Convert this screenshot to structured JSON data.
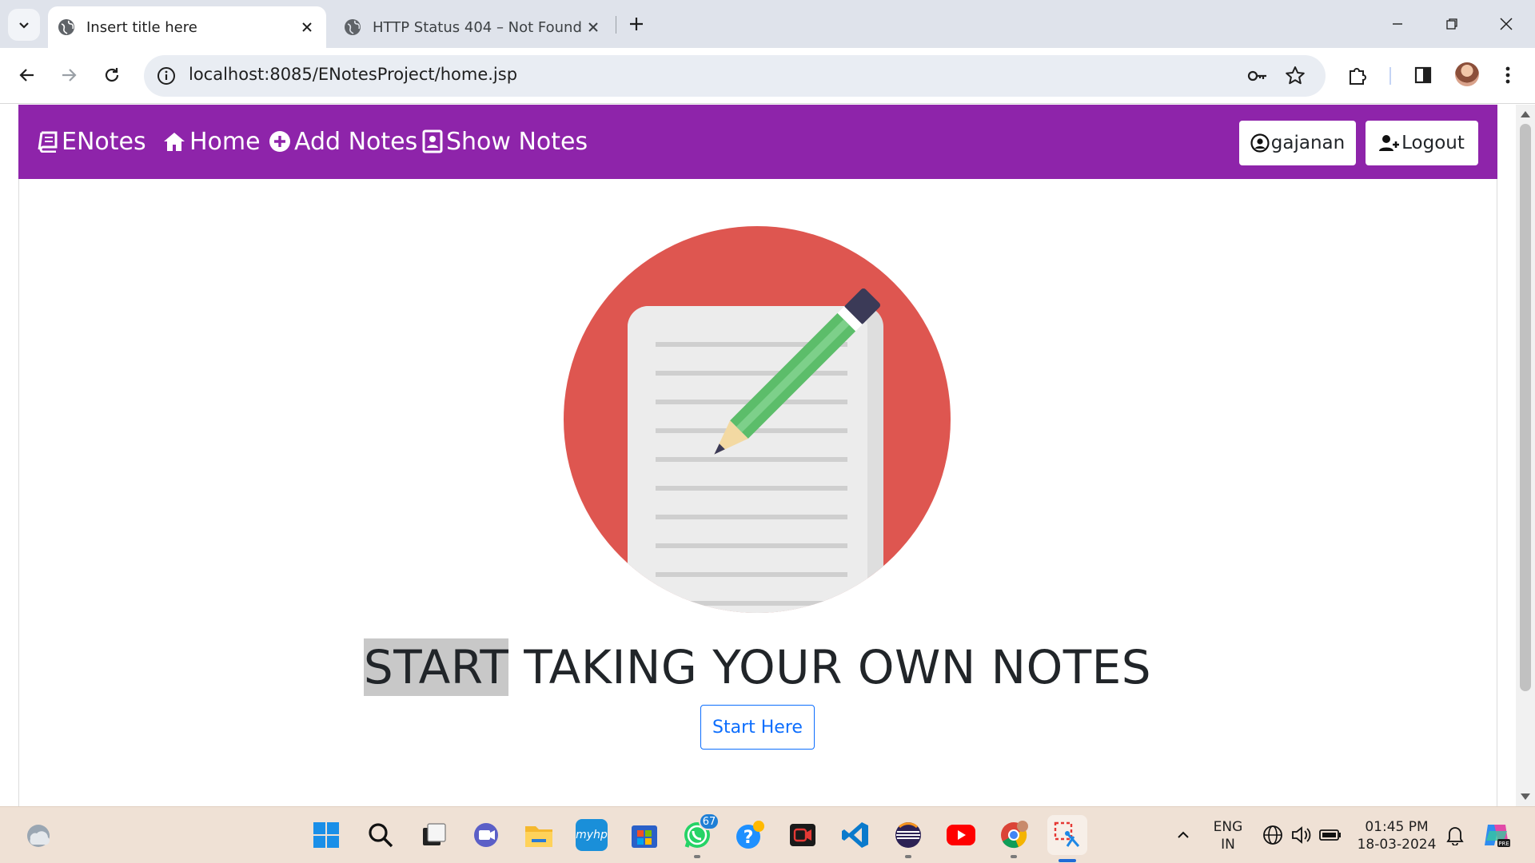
{
  "browser": {
    "tabs": [
      {
        "title": "Insert title here",
        "active": true
      },
      {
        "title": "HTTP Status 404 – Not Found",
        "active": false
      }
    ],
    "url": "localhost:8085/ENotesProject/home.jsp"
  },
  "navbar": {
    "brand": "ENotes",
    "links": [
      "Home",
      "Add Notes",
      "Show Notes"
    ],
    "user_button": "gajanan",
    "logout_button": "Logout",
    "color": "#8e24aa"
  },
  "hero": {
    "headline_highlight": "START",
    "headline_rest": " TAKING YOUR OWN NOTES",
    "start_button": "Start Here"
  },
  "taskbar": {
    "whatsapp_badge": "67",
    "lang_line1": "ENG",
    "lang_line2": "IN",
    "time": "01:45 PM",
    "date": "18-03-2024",
    "icons": [
      "weather-icon",
      "start-icon",
      "search-icon",
      "task-view-icon",
      "teams-icon",
      "file-explorer-icon",
      "myhp-icon",
      "store-icon",
      "whatsapp-icon",
      "help-icon",
      "screen-recorder-icon",
      "vscode-icon",
      "eclipse-icon",
      "youtube-icon",
      "chrome-icon",
      "snipping-tool-icon"
    ]
  }
}
